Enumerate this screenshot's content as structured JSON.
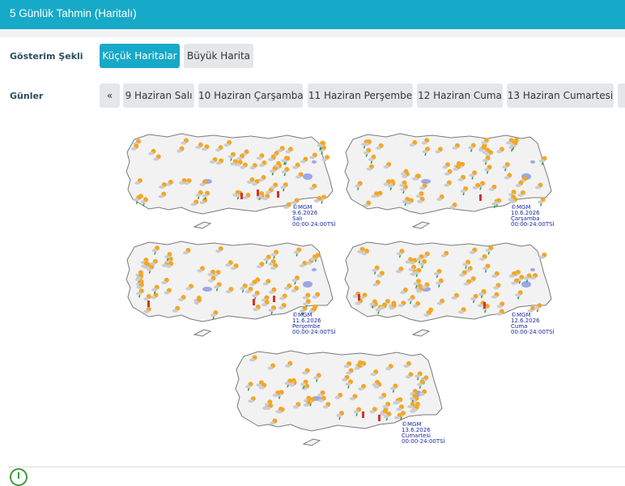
{
  "header": {
    "title": "5 Günlük Tahmin (Haritalı)"
  },
  "display_mode": {
    "label": "Gösterim Şekli",
    "options": [
      "Küçük Haritalar",
      "Büyük Harita"
    ],
    "selected": "Küçük Haritalar"
  },
  "days": {
    "label": "Günler",
    "prev": "«",
    "next": "»",
    "items": [
      "9 Haziran Salı",
      "10 Haziran Çarşamba",
      "11 Haziran Perşembe",
      "12 Haziran Cuma",
      "13 Haziran Cumartesi"
    ]
  },
  "maps": [
    {
      "copyright": "©MGM",
      "date": "9.6.2026",
      "day": "Salı",
      "time": "00:00-24:00TSİ"
    },
    {
      "copyright": "©MGM",
      "date": "10.6.2026",
      "day": "Çarşamba",
      "time": "00:00-24:00TSİ"
    },
    {
      "copyright": "©MGM",
      "date": "11.6.2026",
      "day": "Perşembe",
      "time": "00:00-24:00TSİ"
    },
    {
      "copyright": "©MGM",
      "date": "12.6.2026",
      "day": "Cuma",
      "time": "00:00-24:00TSİ"
    },
    {
      "copyright": "©MGM",
      "date": "13.6.2026",
      "day": "Cumartesi",
      "time": "00:00-24:00TSİ"
    }
  ],
  "colors": {
    "accent": "#17a9c8",
    "sun": "#f5a623",
    "cloud": "#c9ccd2",
    "rain": "#2e9a3a",
    "storm": "#d93025",
    "lake": "#9aa8e6",
    "caption": "#1a2aa0"
  }
}
